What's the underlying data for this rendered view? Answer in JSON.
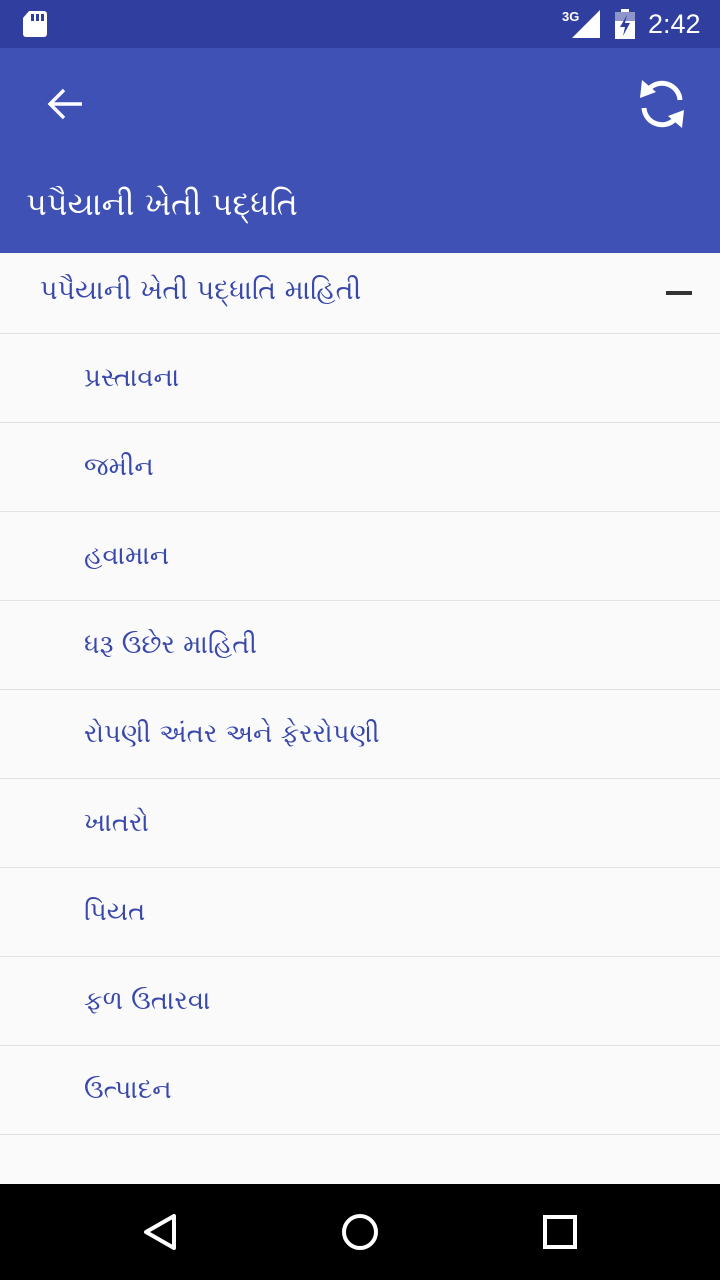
{
  "status_bar": {
    "network": "3G",
    "time": "2:42"
  },
  "app_bar": {
    "title": "પપૈયાની ખેતી પદ્ધતિ"
  },
  "group": {
    "title": "પપૈયાની ખેતી પદ્ધાતિ માહિતી"
  },
  "items": [
    {
      "label": "પ્રસ્તાવના"
    },
    {
      "label": "જમીન"
    },
    {
      "label": "હવામાન"
    },
    {
      "label": "ધરૂ ઉછેર માહિતી"
    },
    {
      "label": "રોપણી અંતર અને ફેરરોપણી"
    },
    {
      "label": "ખાતરો"
    },
    {
      "label": "પિયત"
    },
    {
      "label": "ફળ ઉતારવા"
    },
    {
      "label": "ઉત્પાદન"
    },
    {
      "label": ""
    }
  ],
  "colors": {
    "status_bar": "#303f9f",
    "app_bar": "#3f51b5",
    "item_text": "#3949ab",
    "divider": "#e3e3e3",
    "nav_bar": "#000000"
  },
  "icons": {
    "status": [
      "sd-card-icon",
      "signal-3g-icon",
      "battery-charging-icon"
    ],
    "app_bar": [
      "back-arrow-icon",
      "refresh-icon"
    ],
    "group": "collapse-minus-icon",
    "nav": [
      "nav-back-icon",
      "nav-home-icon",
      "nav-recent-icon"
    ]
  }
}
